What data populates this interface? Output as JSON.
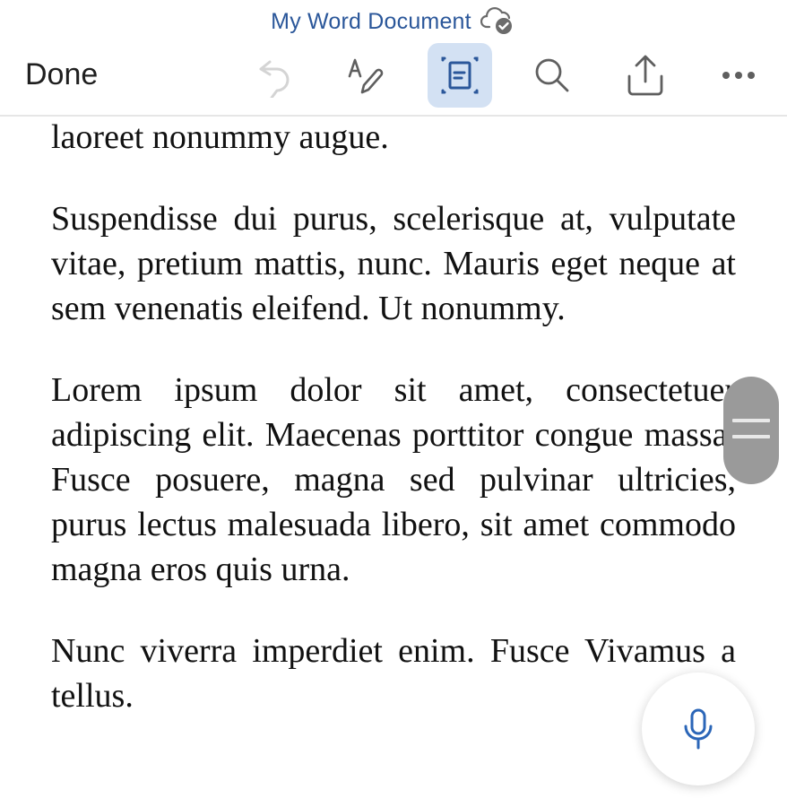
{
  "header": {
    "title": "My Word Document",
    "sync_status_icon": "cloud-check-icon"
  },
  "toolbar": {
    "done_label": "Done",
    "buttons": [
      {
        "name": "undo",
        "icon": "undo-icon",
        "enabled": false
      },
      {
        "name": "format",
        "icon": "text-format-pen-icon",
        "enabled": true
      },
      {
        "name": "mobile-view",
        "icon": "mobile-view-icon",
        "active": true
      },
      {
        "name": "search",
        "icon": "search-icon",
        "enabled": true
      },
      {
        "name": "share",
        "icon": "share-icon",
        "enabled": true
      },
      {
        "name": "more",
        "icon": "more-icon",
        "enabled": true
      }
    ],
    "active_color": "#d3e1f3",
    "accent_color": "#2b579a"
  },
  "document": {
    "paragraphs": [
      "laoreet nonummy augue.",
      "Suspendisse dui purus, scelerisque at, vulputate vitae, pretium mattis, nunc. Mauris eget neque at sem venenatis eleifend. Ut nonummy.",
      "Lorem ipsum dolor sit amet, consectetuer adipiscing elit. Maecenas porttitor congue massa. Fusce posuere, magna sed pulvinar ultricies, purus lectus malesuada libero, sit amet commodo magna eros quis urna.",
      "Nunc viverra imperdiet enim. Fusce Vivamus a tellus."
    ]
  },
  "scroll_handle": {
    "icon": "drag-handle-icon"
  },
  "dictate": {
    "icon": "microphone-icon"
  }
}
